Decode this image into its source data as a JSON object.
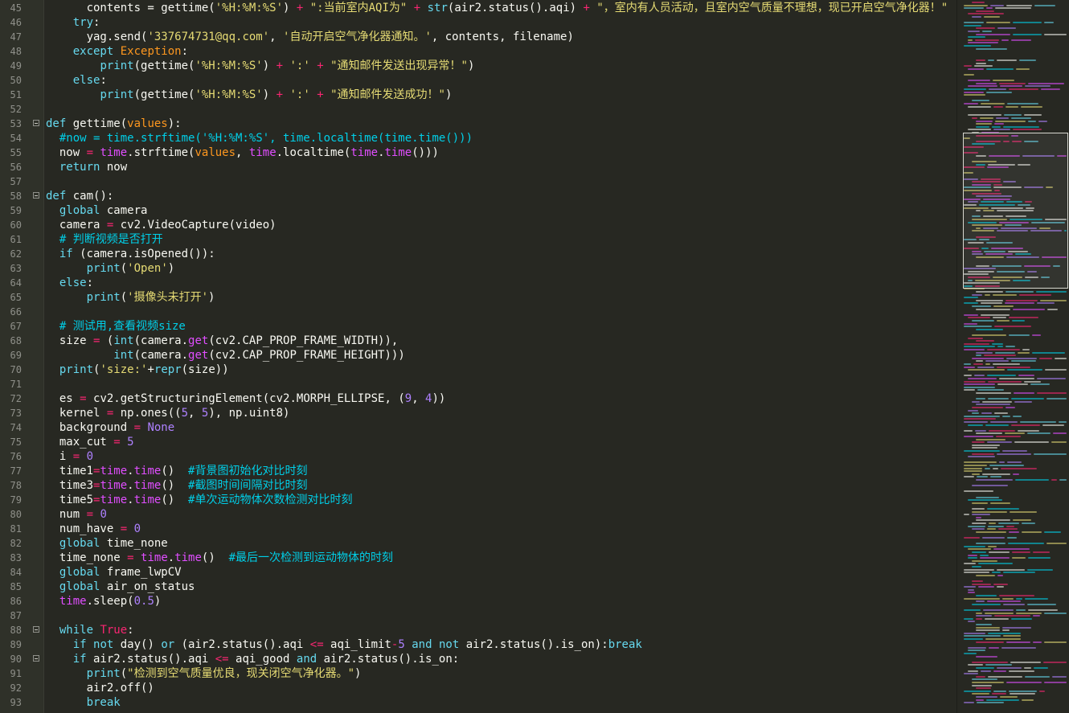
{
  "editor": {
    "lines": [
      {
        "num": "45",
        "segs": [
          [
            "      contents = gettime(",
            ""
          ],
          [
            "'%H:%M:%S'",
            "s"
          ],
          [
            ") ",
            ""
          ],
          [
            "+",
            "o"
          ],
          [
            " \":当前室内AQI为\" ",
            "s"
          ],
          [
            "+ ",
            "o"
          ],
          [
            "str",
            "k"
          ],
          [
            "(air2.status().aqi) ",
            ""
          ],
          [
            "+",
            "o"
          ],
          [
            " \"，室内有人员活动，且室内空气质量不理想，现已开启空气净化器！\"",
            "s"
          ]
        ]
      },
      {
        "num": "46",
        "segs": [
          [
            "    ",
            ""
          ],
          [
            "try",
            "k"
          ],
          [
            ":",
            ""
          ]
        ]
      },
      {
        "num": "47",
        "segs": [
          [
            "      yag.send(",
            ""
          ],
          [
            "'337674731@qq.com'",
            "s"
          ],
          [
            ", ",
            ""
          ],
          [
            "'自动开启空气净化器通知。'",
            "s"
          ],
          [
            ", contents, filename)",
            ""
          ]
        ]
      },
      {
        "num": "48",
        "segs": [
          [
            "    ",
            ""
          ],
          [
            "except",
            "k"
          ],
          [
            " ",
            ""
          ],
          [
            "Exception",
            "p"
          ],
          [
            ":",
            ""
          ]
        ]
      },
      {
        "num": "49",
        "segs": [
          [
            "        ",
            ""
          ],
          [
            "print",
            "k"
          ],
          [
            "(gettime(",
            ""
          ],
          [
            "'%H:%M:%S'",
            "s"
          ],
          [
            ") ",
            ""
          ],
          [
            "+",
            "o"
          ],
          [
            " ",
            ""
          ],
          [
            "':'",
            "s"
          ],
          [
            " ",
            ""
          ],
          [
            "+",
            "o"
          ],
          [
            " ",
            ""
          ],
          [
            "\"通知邮件发送出现异常！\"",
            "s"
          ],
          [
            ")",
            ""
          ]
        ]
      },
      {
        "num": "50",
        "segs": [
          [
            "    ",
            ""
          ],
          [
            "else",
            "k"
          ],
          [
            ":",
            ""
          ]
        ]
      },
      {
        "num": "51",
        "segs": [
          [
            "        ",
            ""
          ],
          [
            "print",
            "k"
          ],
          [
            "(gettime(",
            ""
          ],
          [
            "'%H:%M:%S'",
            "s"
          ],
          [
            ") ",
            ""
          ],
          [
            "+",
            "o"
          ],
          [
            " ",
            ""
          ],
          [
            "':'",
            "s"
          ],
          [
            " ",
            ""
          ],
          [
            "+",
            "o"
          ],
          [
            " ",
            ""
          ],
          [
            "\"通知邮件发送成功！\"",
            "s"
          ],
          [
            ")",
            ""
          ]
        ]
      },
      {
        "num": "52",
        "segs": []
      },
      {
        "num": "53",
        "fold": true,
        "segs": [
          [
            "def",
            "k"
          ],
          [
            " gettime(",
            ""
          ],
          [
            "values",
            "p"
          ],
          [
            "):",
            ""
          ]
        ]
      },
      {
        "num": "54",
        "segs": [
          [
            "  ",
            ""
          ],
          [
            "#now = time.strftime('%H:%M:%S', time.localtime(time.time()))",
            "c"
          ]
        ]
      },
      {
        "num": "55",
        "segs": [
          [
            "  now ",
            ""
          ],
          [
            "=",
            "o"
          ],
          [
            " ",
            ""
          ],
          [
            "time",
            "b"
          ],
          [
            ".strftime(",
            ""
          ],
          [
            "values",
            "p"
          ],
          [
            ", ",
            ""
          ],
          [
            "time",
            "b"
          ],
          [
            ".localtime(",
            ""
          ],
          [
            "time",
            "b"
          ],
          [
            ".",
            ""
          ],
          [
            "time",
            "b"
          ],
          [
            "()))",
            ""
          ]
        ]
      },
      {
        "num": "56",
        "segs": [
          [
            "  ",
            ""
          ],
          [
            "return",
            "k"
          ],
          [
            " now",
            ""
          ]
        ]
      },
      {
        "num": "57",
        "segs": []
      },
      {
        "num": "58",
        "fold": true,
        "segs": [
          [
            "def",
            "k"
          ],
          [
            " cam():",
            ""
          ]
        ]
      },
      {
        "num": "59",
        "segs": [
          [
            "  ",
            ""
          ],
          [
            "global",
            "k"
          ],
          [
            " camera",
            ""
          ]
        ]
      },
      {
        "num": "60",
        "segs": [
          [
            "  camera ",
            ""
          ],
          [
            "=",
            "o"
          ],
          [
            " cv2.VideoCapture(video)",
            ""
          ]
        ]
      },
      {
        "num": "61",
        "segs": [
          [
            "  ",
            ""
          ],
          [
            "# 判断视频是否打开",
            "c"
          ]
        ]
      },
      {
        "num": "62",
        "segs": [
          [
            "  ",
            ""
          ],
          [
            "if",
            "k"
          ],
          [
            " (camera.isOpened()):",
            ""
          ]
        ]
      },
      {
        "num": "63",
        "segs": [
          [
            "      ",
            ""
          ],
          [
            "print",
            "k"
          ],
          [
            "(",
            ""
          ],
          [
            "'Open'",
            "s"
          ],
          [
            ")",
            ""
          ]
        ]
      },
      {
        "num": "64",
        "segs": [
          [
            "  ",
            ""
          ],
          [
            "else",
            "k"
          ],
          [
            ":",
            ""
          ]
        ]
      },
      {
        "num": "65",
        "segs": [
          [
            "      ",
            ""
          ],
          [
            "print",
            "k"
          ],
          [
            "(",
            ""
          ],
          [
            "'摄像头未打开'",
            "s"
          ],
          [
            ")",
            ""
          ]
        ]
      },
      {
        "num": "66",
        "segs": []
      },
      {
        "num": "67",
        "segs": [
          [
            "  ",
            ""
          ],
          [
            "# 测试用,查看视频size",
            "c"
          ]
        ]
      },
      {
        "num": "68",
        "segs": [
          [
            "  size ",
            ""
          ],
          [
            "=",
            "o"
          ],
          [
            " (",
            ""
          ],
          [
            "int",
            "k"
          ],
          [
            "(camera.",
            ""
          ],
          [
            "get",
            "b"
          ],
          [
            "(cv2.CAP_PROP_FRAME_WIDTH)),",
            ""
          ]
        ]
      },
      {
        "num": "69",
        "segs": [
          [
            "          ",
            ""
          ],
          [
            "int",
            "k"
          ],
          [
            "(camera.",
            ""
          ],
          [
            "get",
            "b"
          ],
          [
            "(cv2.CAP_PROP_FRAME_HEIGHT)))",
            ""
          ]
        ]
      },
      {
        "num": "70",
        "segs": [
          [
            "  ",
            ""
          ],
          [
            "print",
            "k"
          ],
          [
            "(",
            ""
          ],
          [
            "'size:'",
            "s"
          ],
          [
            "+",
            ""
          ],
          [
            "repr",
            "k"
          ],
          [
            "(size))",
            ""
          ]
        ]
      },
      {
        "num": "71",
        "segs": []
      },
      {
        "num": "72",
        "segs": [
          [
            "  es ",
            ""
          ],
          [
            "=",
            "o"
          ],
          [
            " cv2.getStructuringElement(cv2.MORPH_ELLIPSE, (",
            ""
          ],
          [
            "9",
            "n"
          ],
          [
            ", ",
            ""
          ],
          [
            "4",
            "n"
          ],
          [
            "))",
            ""
          ]
        ]
      },
      {
        "num": "73",
        "segs": [
          [
            "  kernel ",
            ""
          ],
          [
            "=",
            "o"
          ],
          [
            " np.ones((",
            ""
          ],
          [
            "5",
            "n"
          ],
          [
            ", ",
            ""
          ],
          [
            "5",
            "n"
          ],
          [
            "), np.uint8)",
            ""
          ]
        ]
      },
      {
        "num": "74",
        "segs": [
          [
            "  background ",
            ""
          ],
          [
            "=",
            "o"
          ],
          [
            " ",
            ""
          ],
          [
            "None",
            "n"
          ]
        ]
      },
      {
        "num": "75",
        "segs": [
          [
            "  max_cut ",
            ""
          ],
          [
            "=",
            "o"
          ],
          [
            " ",
            ""
          ],
          [
            "5",
            "n"
          ]
        ]
      },
      {
        "num": "76",
        "segs": [
          [
            "  i ",
            ""
          ],
          [
            "=",
            "o"
          ],
          [
            " ",
            ""
          ],
          [
            "0",
            "n"
          ]
        ]
      },
      {
        "num": "77",
        "segs": [
          [
            "  time1",
            ""
          ],
          [
            "=",
            "o"
          ],
          [
            "time",
            "b"
          ],
          [
            ".",
            ""
          ],
          [
            "time",
            "b"
          ],
          [
            "()  ",
            ""
          ],
          [
            "#背景图初始化对比时刻",
            "c"
          ]
        ]
      },
      {
        "num": "78",
        "segs": [
          [
            "  time3",
            ""
          ],
          [
            "=",
            "o"
          ],
          [
            "time",
            "b"
          ],
          [
            ".",
            ""
          ],
          [
            "time",
            "b"
          ],
          [
            "()  ",
            ""
          ],
          [
            "#截图时间间隔对比时刻",
            "c"
          ]
        ]
      },
      {
        "num": "79",
        "segs": [
          [
            "  time5",
            ""
          ],
          [
            "=",
            "o"
          ],
          [
            "time",
            "b"
          ],
          [
            ".",
            ""
          ],
          [
            "time",
            "b"
          ],
          [
            "()  ",
            ""
          ],
          [
            "#单次运动物体次数检测对比时刻",
            "c"
          ]
        ]
      },
      {
        "num": "80",
        "segs": [
          [
            "  num ",
            ""
          ],
          [
            "=",
            "o"
          ],
          [
            " ",
            ""
          ],
          [
            "0",
            "n"
          ]
        ]
      },
      {
        "num": "81",
        "segs": [
          [
            "  num_have ",
            ""
          ],
          [
            "=",
            "o"
          ],
          [
            " ",
            ""
          ],
          [
            "0",
            "n"
          ]
        ]
      },
      {
        "num": "82",
        "segs": [
          [
            "  ",
            ""
          ],
          [
            "global",
            "k"
          ],
          [
            " time_none",
            ""
          ]
        ]
      },
      {
        "num": "83",
        "segs": [
          [
            "  time_none ",
            ""
          ],
          [
            "=",
            "o"
          ],
          [
            " ",
            ""
          ],
          [
            "time",
            "b"
          ],
          [
            ".",
            ""
          ],
          [
            "time",
            "b"
          ],
          [
            "()  ",
            ""
          ],
          [
            "#最后一次检测到运动物体的时刻",
            "c"
          ]
        ]
      },
      {
        "num": "84",
        "segs": [
          [
            "  ",
            ""
          ],
          [
            "global",
            "k"
          ],
          [
            " frame_lwpCV",
            ""
          ]
        ]
      },
      {
        "num": "85",
        "segs": [
          [
            "  ",
            ""
          ],
          [
            "global",
            "k"
          ],
          [
            " air_on_status",
            ""
          ]
        ]
      },
      {
        "num": "86",
        "segs": [
          [
            "  ",
            ""
          ],
          [
            "time",
            "b"
          ],
          [
            ".sleep(",
            ""
          ],
          [
            "0.5",
            "n"
          ],
          [
            ")",
            ""
          ]
        ]
      },
      {
        "num": "87",
        "segs": []
      },
      {
        "num": "88",
        "fold": true,
        "segs": [
          [
            "  ",
            ""
          ],
          [
            "while",
            "k"
          ],
          [
            " ",
            ""
          ],
          [
            "True",
            "o"
          ],
          [
            ":",
            ""
          ]
        ]
      },
      {
        "num": "89",
        "segs": [
          [
            "    ",
            ""
          ],
          [
            "if",
            "k"
          ],
          [
            " ",
            ""
          ],
          [
            "not",
            "k"
          ],
          [
            " day() ",
            ""
          ],
          [
            "or",
            "k"
          ],
          [
            " (air2.status().aqi ",
            ""
          ],
          [
            "<=",
            "o"
          ],
          [
            " aqi_limit",
            ""
          ],
          [
            "-",
            "o"
          ],
          [
            "5",
            "n"
          ],
          [
            " ",
            ""
          ],
          [
            "and",
            "k"
          ],
          [
            " ",
            ""
          ],
          [
            "not",
            "k"
          ],
          [
            " air2.status().is_on):",
            ""
          ],
          [
            "break",
            "k"
          ]
        ]
      },
      {
        "num": "90",
        "fold": true,
        "segs": [
          [
            "    ",
            ""
          ],
          [
            "if",
            "k"
          ],
          [
            " air2.status().aqi ",
            ""
          ],
          [
            "<=",
            "o"
          ],
          [
            " aqi_good ",
            ""
          ],
          [
            "and",
            "k"
          ],
          [
            " air2.status().is_on:",
            ""
          ]
        ]
      },
      {
        "num": "91",
        "segs": [
          [
            "      ",
            ""
          ],
          [
            "print",
            "k"
          ],
          [
            "(",
            ""
          ],
          [
            "\"检测到空气质量优良，现关闭空气净化器。\"",
            "s"
          ],
          [
            ")",
            ""
          ]
        ]
      },
      {
        "num": "92",
        "segs": [
          [
            "      air2.off()",
            ""
          ]
        ]
      },
      {
        "num": "93",
        "segs": [
          [
            "      ",
            ""
          ],
          [
            "break",
            "k"
          ]
        ]
      }
    ]
  },
  "colors": {
    "background": "#272822",
    "gutter": "#2f3129",
    "keyword": "#66d9ef",
    "operator": "#f92672",
    "string": "#e6db74",
    "number": "#ae81ff",
    "comment": "#00cfe8",
    "builtin_module": "#e04eff",
    "param": "#fd971f"
  },
  "icons": {
    "fold": "fold-toggle-icon"
  }
}
